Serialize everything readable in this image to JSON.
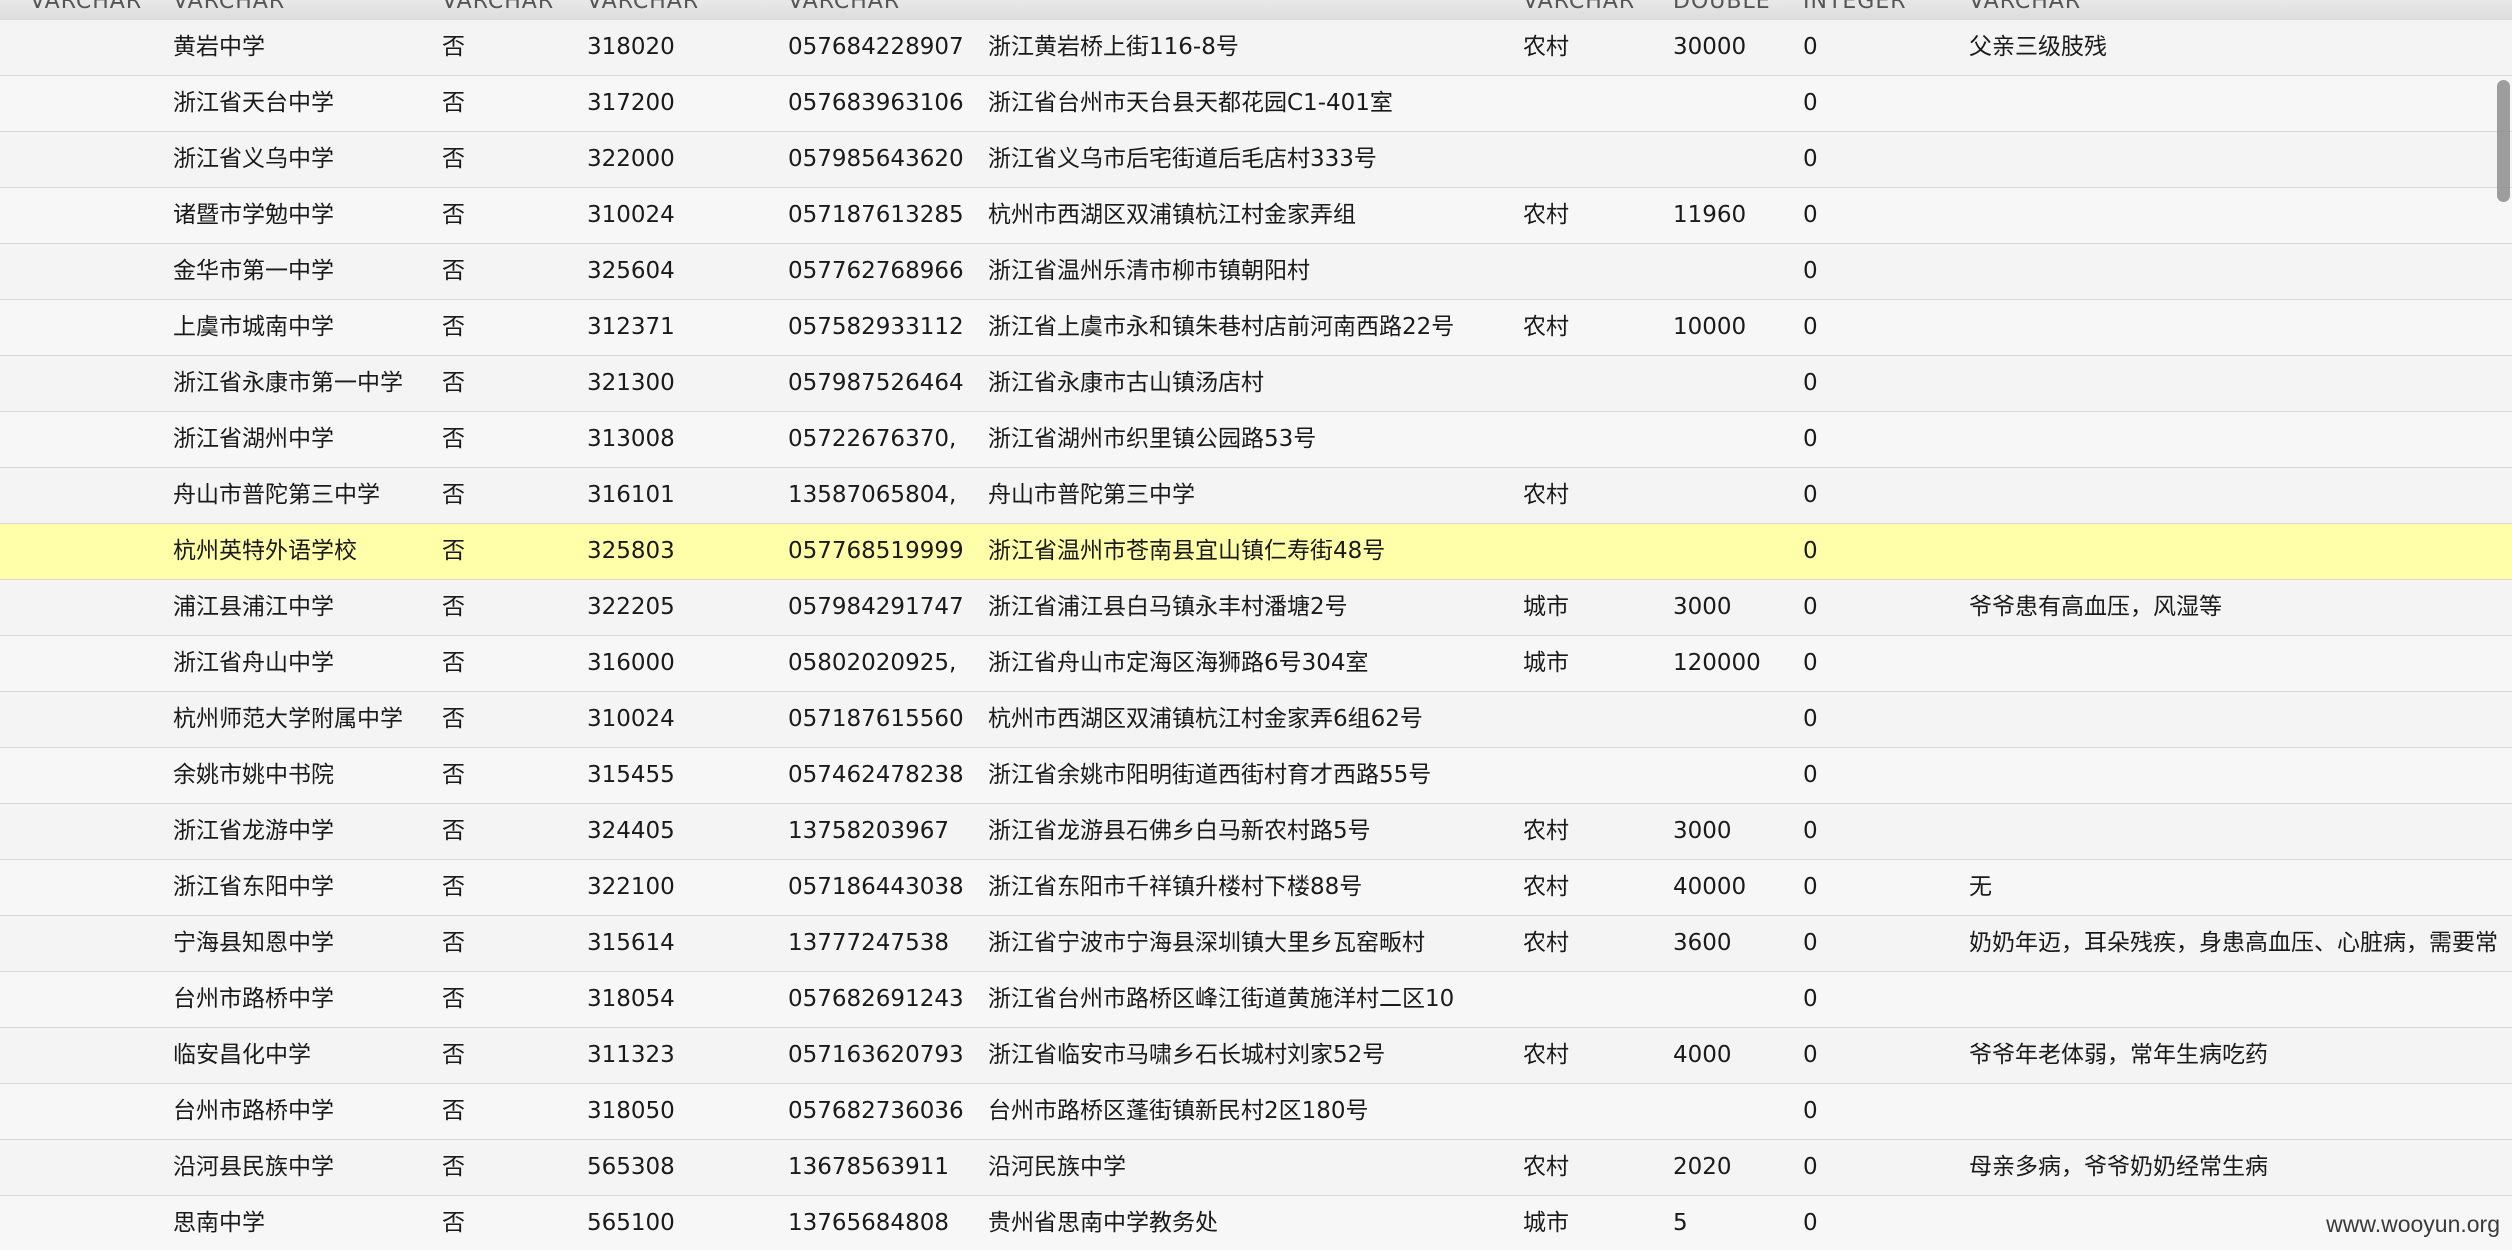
{
  "header": {
    "columns": [
      "VARCHAR",
      "VARCHAR",
      "VARCHAR",
      "VARCHAR",
      "VARCHAR",
      "VARCHAR",
      "DOUBLE",
      "INTEGER",
      "VARCHAR"
    ]
  },
  "rows": [
    {
      "name": "黄岩中学",
      "flag": "否",
      "zip": "318020",
      "phone": "057684228907",
      "address": "浙江黄岩桥上街116-8号",
      "area": "农村",
      "income": "30000",
      "count": "0",
      "note": "父亲三级肢残"
    },
    {
      "name": "浙江省天台中学",
      "flag": "否",
      "zip": "317200",
      "phone": "057683963106",
      "address": "浙江省台州市天台县天都花园C1-401室",
      "area": "",
      "income": "",
      "count": "0",
      "note": ""
    },
    {
      "name": "浙江省义乌中学",
      "flag": "否",
      "zip": "322000",
      "phone": "057985643620",
      "address": "浙江省义乌市后宅街道后毛店村333号",
      "area": "",
      "income": "",
      "count": "0",
      "note": ""
    },
    {
      "name": "诸暨市学勉中学",
      "flag": "否",
      "zip": "310024",
      "phone": "057187613285",
      "address": "杭州市西湖区双浦镇杭江村金家弄组",
      "area": "农村",
      "income": "11960",
      "count": "0",
      "note": ""
    },
    {
      "name": "金华市第一中学",
      "flag": "否",
      "zip": "325604",
      "phone": "057762768966",
      "address": "浙江省温州乐清市柳市镇朝阳村",
      "area": "",
      "income": "",
      "count": "0",
      "note": ""
    },
    {
      "name": "上虞市城南中学",
      "flag": "否",
      "zip": "312371",
      "phone": "057582933112",
      "address": "浙江省上虞市永和镇朱巷村店前河南西路22号",
      "area": "农村",
      "income": "10000",
      "count": "0",
      "note": ""
    },
    {
      "name": "浙江省永康市第一中学",
      "flag": "否",
      "zip": "321300",
      "phone": "057987526464",
      "address": "浙江省永康市古山镇汤店村",
      "area": "",
      "income": "",
      "count": "0",
      "note": ""
    },
    {
      "name": "浙江省湖州中学",
      "flag": "否",
      "zip": "313008",
      "phone": "05722676370,",
      "address": "浙江省湖州市织里镇公园路53号",
      "area": "",
      "income": "",
      "count": "0",
      "note": ""
    },
    {
      "name": "舟山市普陀第三中学",
      "flag": "否",
      "zip": "316101",
      "phone": "13587065804,",
      "address": "舟山市普陀第三中学",
      "area": "农村",
      "income": "",
      "count": "0",
      "note": ""
    },
    {
      "name": "杭州英特外语学校",
      "flag": "否",
      "zip": "325803",
      "phone": "057768519999",
      "address": "浙江省温州市苍南县宜山镇仁寿街48号",
      "area": "",
      "income": "",
      "count": "0",
      "note": "",
      "selected": true
    },
    {
      "name": "浦江县浦江中学",
      "flag": "否",
      "zip": "322205",
      "phone": "057984291747",
      "address": "浙江省浦江县白马镇永丰村潘塘2号",
      "area": "城市",
      "income": "3000",
      "count": "0",
      "note": "爷爷患有高血压，风湿等"
    },
    {
      "name": "浙江省舟山中学",
      "flag": "否",
      "zip": "316000",
      "phone": "05802020925,",
      "address": "浙江省舟山市定海区海狮路6号304室",
      "area": "城市",
      "income": "120000",
      "count": "0",
      "note": ""
    },
    {
      "name": "杭州师范大学附属中学",
      "flag": "否",
      "zip": "310024",
      "phone": "057187615560",
      "address": "杭州市西湖区双浦镇杭江村金家弄6组62号",
      "area": "",
      "income": "",
      "count": "0",
      "note": ""
    },
    {
      "name": "余姚市姚中书院",
      "flag": "否",
      "zip": "315455",
      "phone": "057462478238",
      "address": "浙江省余姚市阳明街道西街村育才西路55号",
      "area": "",
      "income": "",
      "count": "0",
      "note": ""
    },
    {
      "name": "浙江省龙游中学",
      "flag": "否",
      "zip": "324405",
      "phone": "13758203967",
      "address": "浙江省龙游县石佛乡白马新农村路5号",
      "area": "农村",
      "income": "3000",
      "count": "0",
      "note": ""
    },
    {
      "name": "浙江省东阳中学",
      "flag": "否",
      "zip": "322100",
      "phone": "057186443038",
      "address": "浙江省东阳市千祥镇升楼村下楼88号",
      "area": "农村",
      "income": "40000",
      "count": "0",
      "note": "无"
    },
    {
      "name": "宁海县知恩中学",
      "flag": "否",
      "zip": "315614",
      "phone": "13777247538",
      "address": "浙江省宁波市宁海县深圳镇大里乡瓦窑畈村",
      "area": "农村",
      "income": "3600",
      "count": "0",
      "note": "奶奶年迈，耳朵残疾，身患高血压、心脏病，需要常"
    },
    {
      "name": "台州市路桥中学",
      "flag": "否",
      "zip": "318054",
      "phone": "057682691243",
      "address": "浙江省台州市路桥区峰江街道黄施洋村二区10",
      "area": "",
      "income": "",
      "count": "0",
      "note": ""
    },
    {
      "name": "临安昌化中学",
      "flag": "否",
      "zip": "311323",
      "phone": "057163620793",
      "address": "浙江省临安市马啸乡石长城村刘家52号",
      "area": "农村",
      "income": "4000",
      "count": "0",
      "note": "爷爷年老体弱，常年生病吃药"
    },
    {
      "name": "台州市路桥中学",
      "flag": "否",
      "zip": "318050",
      "phone": "057682736036",
      "address": "台州市路桥区蓬街镇新民村2区180号",
      "area": "",
      "income": "",
      "count": "0",
      "note": ""
    },
    {
      "name": "沿河县民族中学",
      "flag": "否",
      "zip": "565308",
      "phone": "13678563911",
      "address": "沿河民族中学",
      "area": "农村",
      "income": "2020",
      "count": "0",
      "note": "母亲多病，爷爷奶奶经常生病"
    },
    {
      "name": "思南中学",
      "flag": "否",
      "zip": "565100",
      "phone": "13765684808",
      "address": "贵州省思南中学教务处",
      "area": "城市",
      "income": "5",
      "count": "0",
      "note": ""
    }
  ],
  "watermark": "www.wooyun.org"
}
